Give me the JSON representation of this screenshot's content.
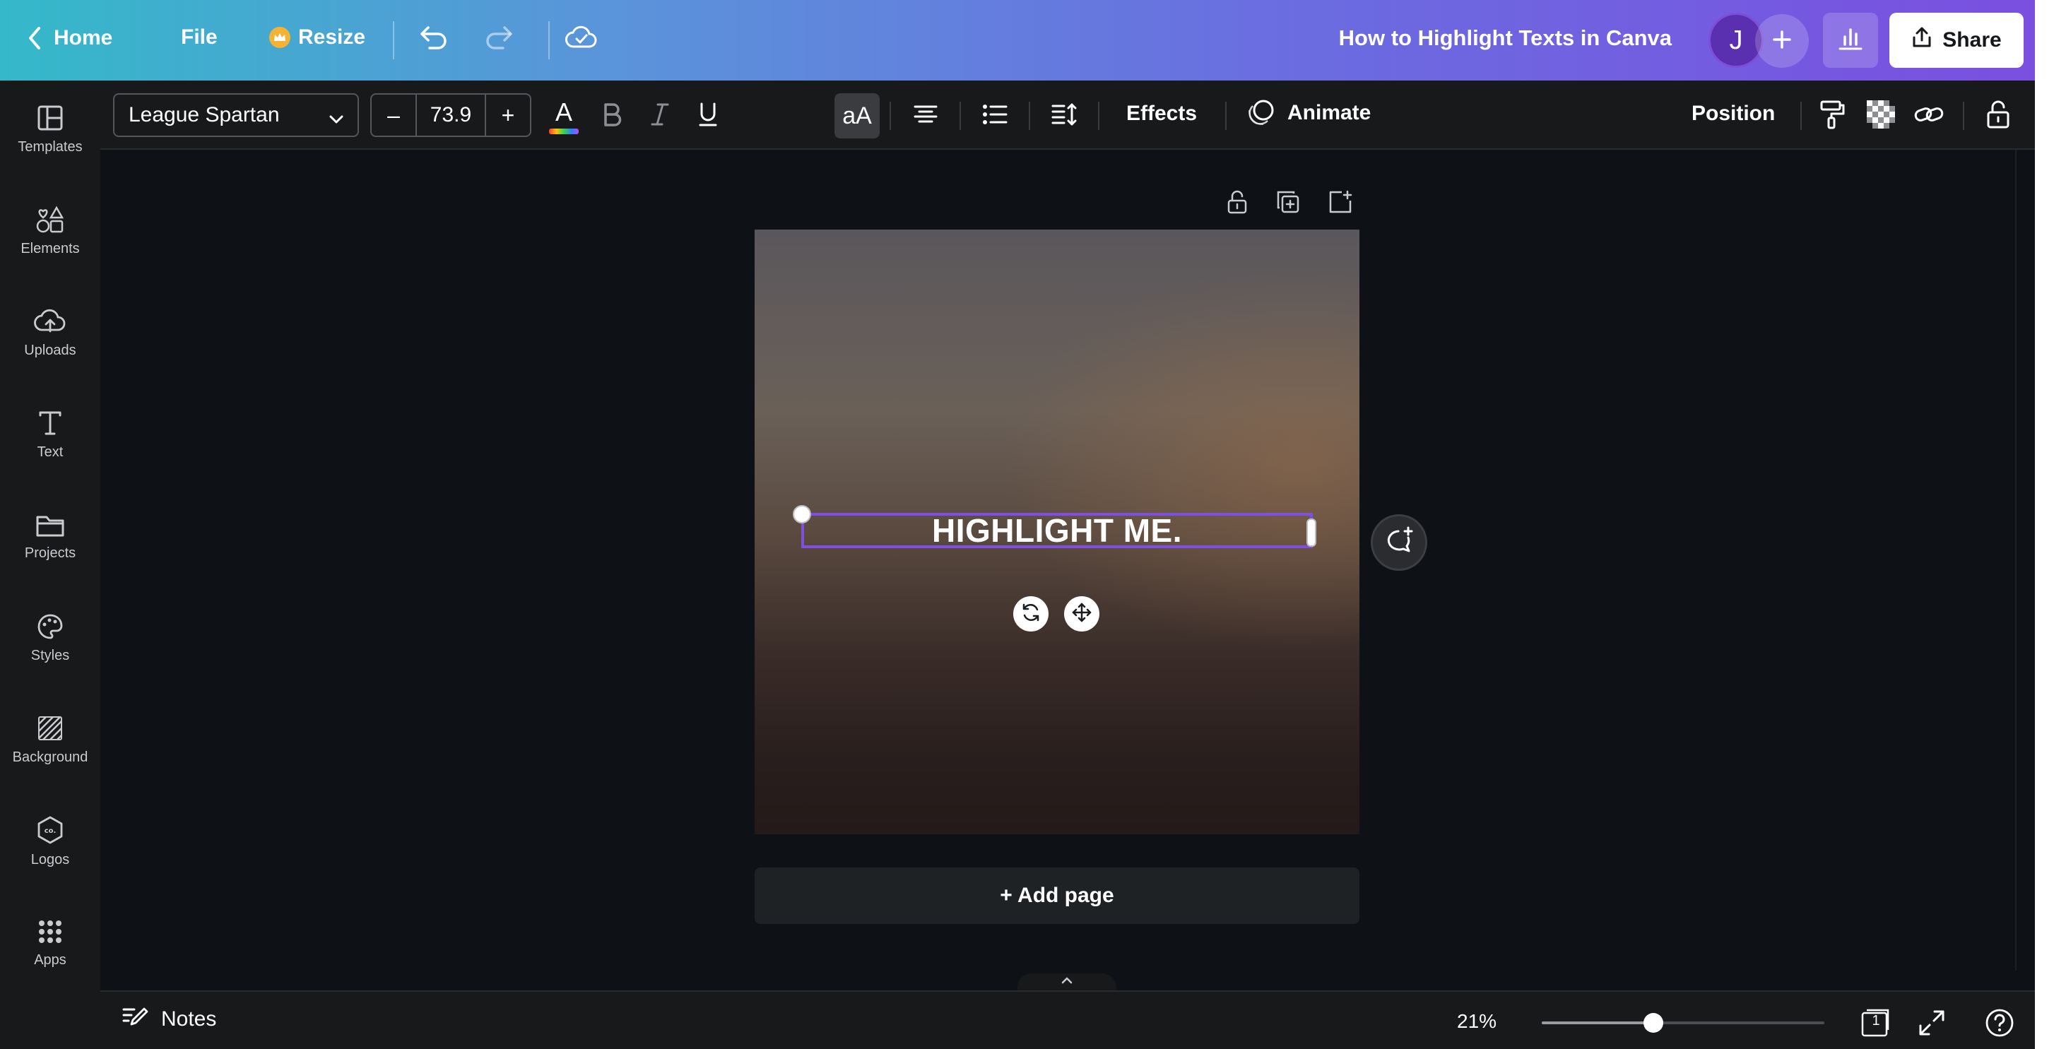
{
  "topbar": {
    "home_label": "Home",
    "file_label": "File",
    "resize_label": "Resize",
    "doc_title": "How to Highlight Texts in Canva",
    "avatar_initial": "J",
    "share_label": "Share",
    "icons": {
      "back": "chevron-left-icon",
      "resize": "crown-icon",
      "undo": "undo-icon",
      "redo": "redo-icon",
      "save_status": "cloud-check-icon",
      "add_collaborator": "plus-icon",
      "analytics": "bar-chart-icon",
      "share": "upload-icon"
    }
  },
  "sidebar": {
    "items": [
      {
        "label": "Templates",
        "icon": "templates-icon"
      },
      {
        "label": "Elements",
        "icon": "elements-icon"
      },
      {
        "label": "Uploads",
        "icon": "cloud-upload-icon"
      },
      {
        "label": "Text",
        "icon": "text-t-icon"
      },
      {
        "label": "Projects",
        "icon": "folder-icon"
      },
      {
        "label": "Styles",
        "icon": "palette-icon"
      },
      {
        "label": "Background",
        "icon": "background-hatch-icon"
      },
      {
        "label": "Logos",
        "icon": "logo-hexagon-icon"
      },
      {
        "label": "Apps",
        "icon": "apps-grid-icon"
      }
    ]
  },
  "toolbar": {
    "font_family": "League Spartan",
    "font_size": "73.9",
    "minus_label": "–",
    "plus_label": "+",
    "case_label": "aA",
    "effects_label": "Effects",
    "animate_label": "Animate",
    "position_label": "Position",
    "text_color_letter": "A"
  },
  "canvas": {
    "text_content": "HIGHLIGHT ME.",
    "add_page_label": "+ Add page"
  },
  "bottombar": {
    "notes_label": "Notes",
    "zoom_label": "21%",
    "zoom_level": 0.21,
    "page_count": "1"
  },
  "colors": {
    "topbar_gradient_start": "#34b9c9",
    "topbar_gradient_end": "#7a4fe0",
    "selection_outline": "#7f4fe0",
    "editor_background": "#0e1115",
    "panel_background": "#18191b"
  }
}
